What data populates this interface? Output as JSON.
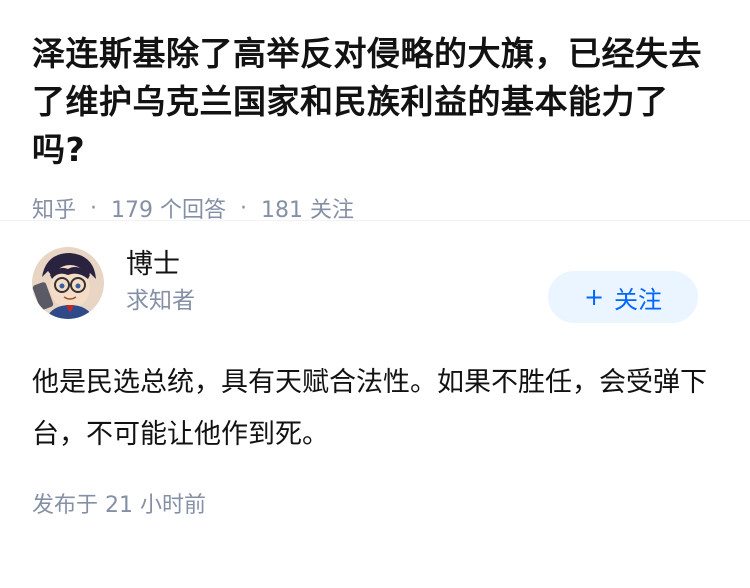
{
  "question": {
    "title": "泽连斯基除了高举反对侵略的大旗，已经失去了维护乌克兰国家和民族利益的基本能力了吗?",
    "source": "知乎",
    "answer_count": "179 个回答",
    "follower_count": "181 关注",
    "separator": "·"
  },
  "answer": {
    "author_name": "博士",
    "author_headline": "求知者",
    "follow_button": {
      "icon": "+",
      "label": "关注"
    },
    "content": "他是民选总统，具有天赋合法性。如果不胜任，会受弹下台，不可能让他作到死。",
    "time": "发布于  21 小时前"
  },
  "colors": {
    "accent": "#0066ff",
    "accent_bg": "#ebf5ff",
    "meta_gray": "#8590a6",
    "text": "#121212"
  }
}
